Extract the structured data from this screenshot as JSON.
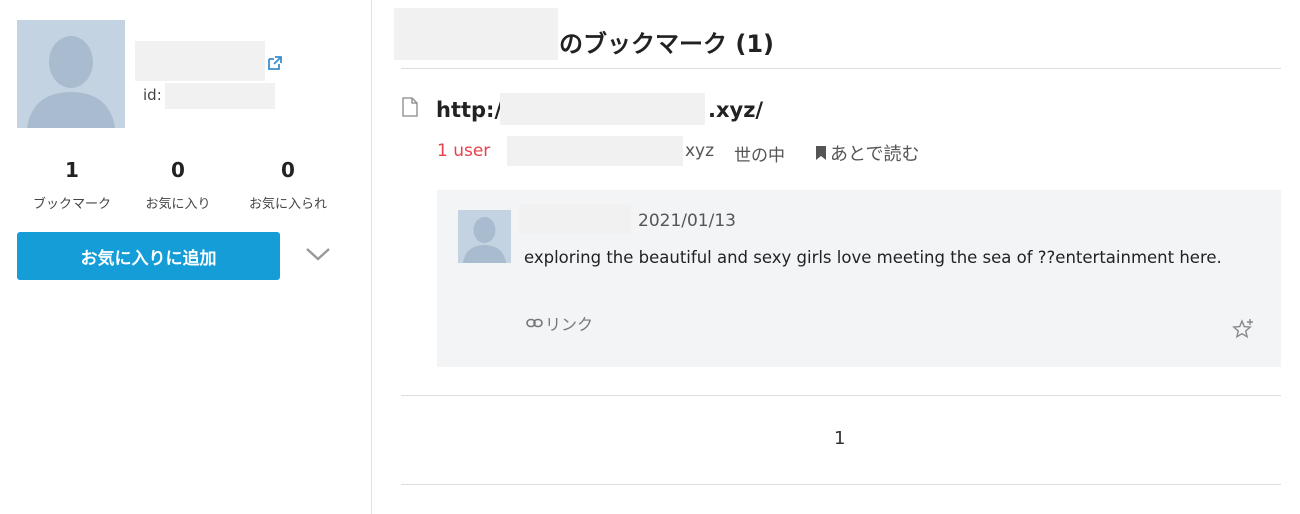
{
  "profile": {
    "id_label": "id:",
    "stats": [
      {
        "value": "1",
        "label": "ブックマーク"
      },
      {
        "value": "0",
        "label": "お気に入り"
      },
      {
        "value": "0",
        "label": "お気に入られ"
      }
    ],
    "add_favorite_label": "お気に入りに追加"
  },
  "main": {
    "title_suffix": "のブックマーク (1)",
    "entry": {
      "url_prefix": "http:/",
      "url_suffix": ".xyz/",
      "users": "1 user",
      "domain_suffix": "xyz",
      "category": "世の中",
      "read_later": "あとで読む"
    },
    "comment": {
      "date": "2021/01/13",
      "text": "exploring the beautiful and sexy girls love meeting the sea of ??entertainment here.",
      "link_label": "リンク"
    },
    "pagination": [
      "1"
    ]
  },
  "colors": {
    "accent": "#159dd8",
    "users": "#e8414a",
    "comment_bg": "#f2f4f6"
  }
}
